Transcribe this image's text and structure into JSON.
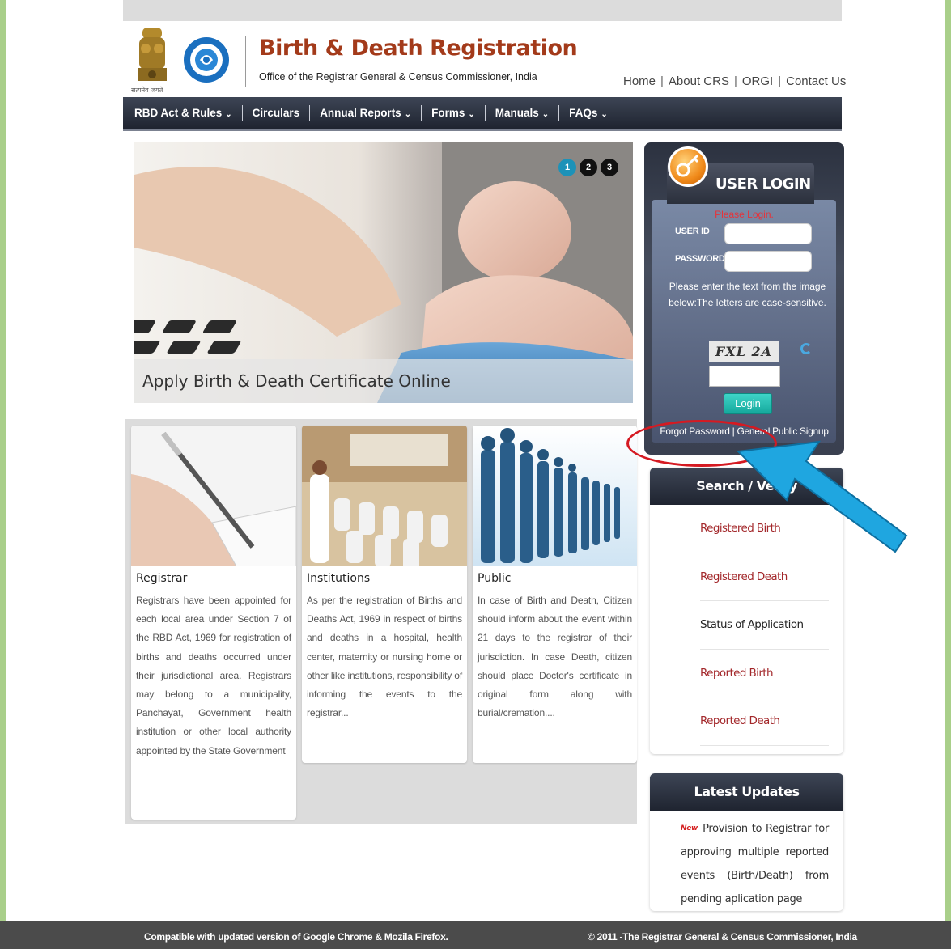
{
  "header": {
    "emblem_caption": "सत्यमेव जयते",
    "title": "Birth & Death Registration",
    "subtitle": "Office of the Registrar General & Census Commissioner, India",
    "links": [
      "Home",
      "About CRS",
      "ORGI",
      "Contact Us"
    ]
  },
  "nav": {
    "items": [
      {
        "label": "RBD Act & Rules",
        "dropdown": true
      },
      {
        "label": "Circulars",
        "dropdown": false
      },
      {
        "label": "Annual Reports",
        "dropdown": true
      },
      {
        "label": "Forms",
        "dropdown": true
      },
      {
        "label": "Manuals",
        "dropdown": true
      },
      {
        "label": "FAQs",
        "dropdown": true
      }
    ],
    "caret": "⌄"
  },
  "banner": {
    "caption": "Apply Birth & Death Certificate Online",
    "slides": [
      "1",
      "2",
      "3"
    ],
    "active_slide": 1
  },
  "cards": [
    {
      "title": "Registrar",
      "text": "Registrars have been appointed for each local area under Section 7 of the RBD Act, 1969 for registration of births and deaths occurred under their jurisdictional area. Registrars may belong to a municipality, Panchayat, Government health institution or other local authority appointed by the State Government"
    },
    {
      "title": "Institutions",
      "text": "As per the registration of Births and Deaths Act, 1969 in respect of births and deaths in a hospital, health center, maternity or nursing home or other like institutions, responsibility of informing the events to the registrar..."
    },
    {
      "title": "Public",
      "text": "In case of Birth and Death, Citizen should inform about the event within 21 days to the registrar of their jurisdiction. In case Death, citizen should place Doctor's certificate in original form along with burial/cremation...."
    }
  ],
  "login": {
    "title": "USER LOGIN",
    "message": "Please Login.",
    "user_id_label": "USER ID",
    "user_id_value": "",
    "password_label": "PASSWORD",
    "password_value": "",
    "captcha_note": "Please enter the text from the image below:The letters are case-sensitive.",
    "captcha_text": "FXL 2A",
    "captcha_value": "",
    "button": "Login",
    "forgot_password": "Forgot Password",
    "link_sep": "|",
    "signup": "General Public Signup"
  },
  "search_verify": {
    "title": "Search / Verify",
    "items": [
      {
        "label": "Registered Birth",
        "style": "link"
      },
      {
        "label": "Registered Death",
        "style": "link"
      },
      {
        "label": "Status of Application",
        "style": "dark"
      },
      {
        "label": "Reported Birth",
        "style": "link"
      },
      {
        "label": "Reported Death",
        "style": "link"
      }
    ]
  },
  "latest_updates": {
    "title": "Latest Updates",
    "badge": "New",
    "text": "Provision to Registrar for approving multiple reported events (Birth/Death) from pending aplication page"
  },
  "footer": {
    "left": "Compatible with updated version of Google Chrome & Mozila Firefox.",
    "right": "© 2011 -The Registrar General & Census Commissioner, India"
  },
  "colors": {
    "title_red": "#a33a1a",
    "nav_dark": "#1f2430",
    "link_red": "#a3282b",
    "annotation_red": "#d51a22",
    "annotation_arrow": "#1fa6e0",
    "page_border": "#a9cf8a"
  }
}
